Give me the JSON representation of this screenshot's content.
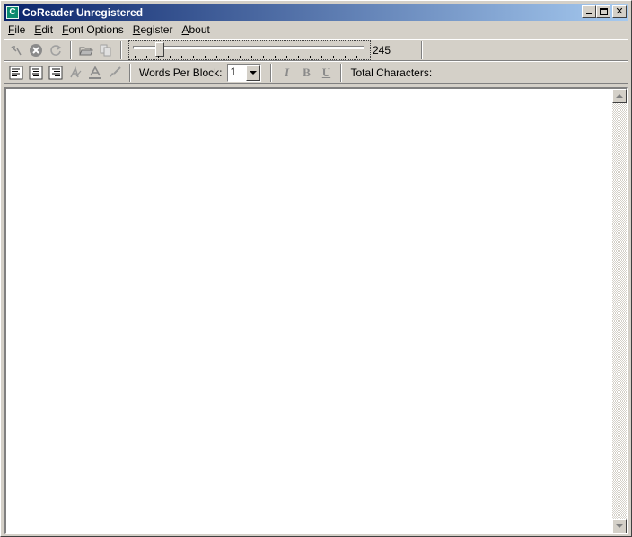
{
  "window": {
    "title": "CoReader Unregistered",
    "app_icon_glyph": "C",
    "controls": {
      "minimize": "minimize-icon",
      "maximize": "maximize-icon",
      "close": "✕"
    }
  },
  "menu": {
    "items": [
      {
        "label": "File",
        "accel": "F",
        "rest": "ile"
      },
      {
        "label": "Edit",
        "accel": "E",
        "rest": "dit"
      },
      {
        "label": "Font Options",
        "accel": "F",
        "rest": "ont Options"
      },
      {
        "label": "Register",
        "accel": "R",
        "rest": "egister"
      },
      {
        "label": "About",
        "accel": "A",
        "rest": "bout"
      }
    ]
  },
  "toolbar1": {
    "icons": [
      "start-reading-icon",
      "stop-icon",
      "refresh-icon",
      "open-folder-icon",
      "copy-icon"
    ],
    "speed_slider": {
      "value": "245",
      "level_fraction": 0.1
    }
  },
  "toolbar2": {
    "align_icons": [
      "align-left-icon",
      "align-center-icon",
      "align-right-icon"
    ],
    "font_icons": [
      "font-style-icon",
      "font-color-icon",
      "brush-icon"
    ],
    "words_per_block_label": "Words Per Block:",
    "words_per_block_value": "1",
    "format": {
      "italic": "I",
      "bold": "B",
      "underline": "U"
    },
    "total_characters_label": "Total Characters:"
  },
  "editor": {
    "text": ""
  }
}
